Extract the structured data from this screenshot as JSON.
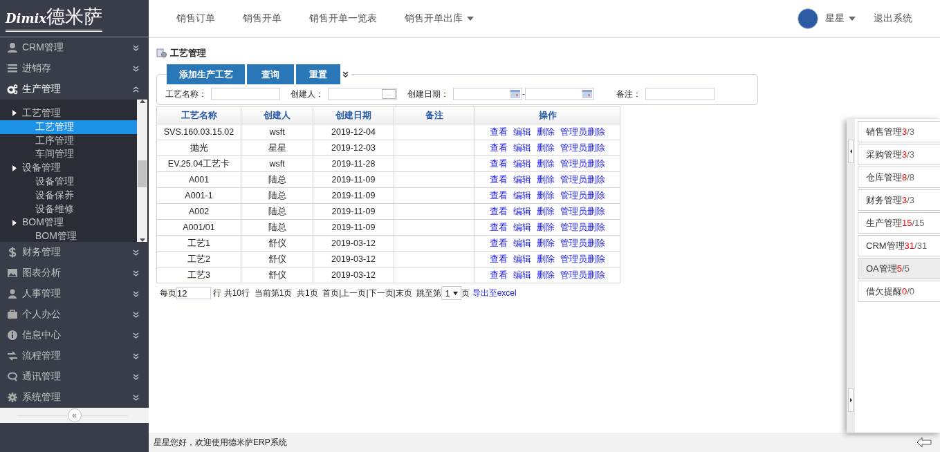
{
  "logo": {
    "brand": "Dimix",
    "name": "德米萨"
  },
  "top_nav": {
    "items": [
      {
        "label": "销售订单",
        "dropdown": false
      },
      {
        "label": "销售开单",
        "dropdown": false
      },
      {
        "label": "销售开单一览表",
        "dropdown": false
      },
      {
        "label": "销售开单出库",
        "dropdown": true
      }
    ],
    "user": "星星",
    "logout": "退出系统"
  },
  "sidebar": {
    "items_top": [
      {
        "label": "CRM管理",
        "expanded": false
      },
      {
        "label": "进销存",
        "expanded": false
      },
      {
        "label": "生产管理",
        "expanded": true
      }
    ],
    "submenu": [
      {
        "label": "工艺管理",
        "children": [
          {
            "label": "工艺管理",
            "selected": true
          },
          {
            "label": "工序管理",
            "selected": false
          },
          {
            "label": "车间管理",
            "selected": false
          }
        ]
      },
      {
        "label": "设备管理",
        "children": [
          {
            "label": "设备管理",
            "selected": false
          },
          {
            "label": "设备保养",
            "selected": false
          },
          {
            "label": "设备维修",
            "selected": false
          }
        ]
      },
      {
        "label": "BOM管理",
        "children": [
          {
            "label": "BOM管理",
            "selected": false
          }
        ]
      }
    ],
    "items_bottom": [
      {
        "label": "财务管理",
        "expanded": false
      },
      {
        "label": "图表分析",
        "expanded": false
      },
      {
        "label": "人事管理",
        "expanded": false
      },
      {
        "label": "个人办公",
        "expanded": false
      },
      {
        "label": "信息中心",
        "expanded": false
      },
      {
        "label": "流程管理",
        "expanded": false
      },
      {
        "label": "通讯管理",
        "expanded": false
      },
      {
        "label": "系统管理",
        "expanded": false
      }
    ],
    "collapse_button": "«"
  },
  "page_title": "工艺管理",
  "buttons": [
    "添加生产工艺",
    "查询",
    "重置"
  ],
  "filters": [
    {
      "kind": "text",
      "label": "工艺名称："
    },
    {
      "kind": "picker",
      "label": "创建人：",
      "picker_button": "..."
    },
    {
      "kind": "daterange",
      "label": "创建日期：",
      "separator": "-"
    },
    {
      "kind": "text",
      "label": "备注："
    }
  ],
  "table": {
    "columns": [
      "工艺名称",
      "创建人",
      "创建日期",
      "备注",
      "操作"
    ],
    "rows": [
      {
        "name": "SVS.160.03.15.02",
        "creator": "wsft",
        "date": "2019-12-04",
        "actions": [
          "查看",
          "编辑",
          "删除",
          "管理员删除"
        ]
      },
      {
        "name": "抛光",
        "creator": "星星",
        "date": "2019-12-03",
        "actions": [
          "查看",
          "编辑",
          "删除",
          "管理员删除"
        ]
      },
      {
        "name": "EV.25.04工艺卡",
        "creator": "wsft",
        "date": "2019-11-28",
        "actions": [
          "查看",
          "编辑",
          "删除",
          "管理员删除"
        ]
      },
      {
        "name": "A001",
        "creator": "陆总",
        "date": "2019-11-09",
        "actions": [
          "查看",
          "编辑",
          "删除",
          "管理员删除"
        ]
      },
      {
        "name": "A001-1",
        "creator": "陆总",
        "date": "2019-11-09",
        "actions": [
          "查看",
          "编辑",
          "删除",
          "管理员删除"
        ]
      },
      {
        "name": "A002",
        "creator": "陆总",
        "date": "2019-11-09",
        "actions": [
          "查看",
          "编辑",
          "删除",
          "管理员删除"
        ]
      },
      {
        "name": "A001/01",
        "creator": "陆总",
        "date": "2019-11-09",
        "actions": [
          "查看",
          "编辑",
          "删除",
          "管理员删除"
        ]
      },
      {
        "name": "工艺1",
        "creator": "舒仪",
        "date": "2019-03-12",
        "actions": [
          "查看",
          "编辑",
          "删除",
          "管理员删除"
        ]
      },
      {
        "name": "工艺2",
        "creator": "舒仪",
        "date": "2019-03-12",
        "actions": [
          "查看",
          "编辑",
          "删除",
          "管理员删除"
        ]
      },
      {
        "name": "工艺3",
        "creator": "舒仪",
        "date": "2019-03-12",
        "actions": [
          "查看",
          "编辑",
          "删除",
          "管理员删除"
        ]
      }
    ]
  },
  "pagination": {
    "per_page_label": "每页",
    "per_page": "12",
    "summary": "行 共10行  当前第1页  共1页  首页|上一页|下一页|末页  跳至第",
    "page": "1",
    "page_suffix": "页",
    "export_link": "导出至excel"
  },
  "notices": [
    {
      "label": "销售管理",
      "count": "3",
      "of_total": "/3",
      "selected": false
    },
    {
      "label": "采购管理",
      "count": "3",
      "of_total": "/3",
      "selected": false
    },
    {
      "label": "仓库管理",
      "count": "8",
      "of_total": "/8",
      "selected": false
    },
    {
      "label": "财务管理",
      "count": "3",
      "of_total": "/3",
      "selected": false
    },
    {
      "label": "生产管理",
      "count": "15",
      "of_total": "/15",
      "selected": false
    },
    {
      "label": "CRM管理",
      "count": "31",
      "of_total": "/31",
      "selected": false
    },
    {
      "label": "OA管理",
      "count": "5",
      "of_total": "/5",
      "selected": true
    },
    {
      "label": "借欠提醒",
      "count": "0",
      "of_total": "/0",
      "selected": false
    }
  ],
  "status_bar": "星星您好，欢迎使用德米萨ERP系统"
}
